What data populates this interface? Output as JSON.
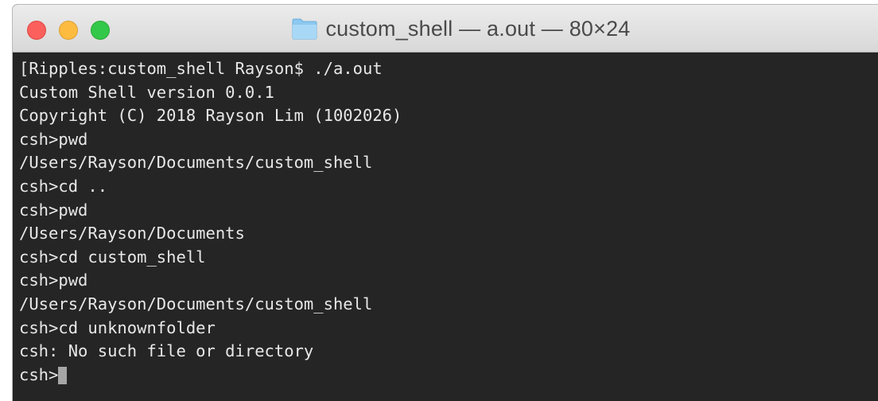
{
  "window": {
    "title": "custom_shell — a.out — 80×24"
  },
  "terminal": {
    "lines": [
      "[Ripples:custom_shell Rayson$ ./a.out",
      "Custom Shell version 0.0.1",
      "Copyright (C) 2018 Rayson Lim (1002026)",
      "csh>pwd",
      "/Users/Rayson/Documents/custom_shell",
      "csh>cd ..",
      "csh>pwd",
      "/Users/Rayson/Documents",
      "csh>cd custom_shell",
      "csh>pwd",
      "/Users/Rayson/Documents/custom_shell",
      "csh>cd unknownfolder",
      "csh: No such file or directory"
    ],
    "prompt": "csh>"
  },
  "colors": {
    "terminal_bg": "#252525",
    "terminal_fg": "#e8e8e8",
    "close": "#fc605c",
    "minimize": "#fdbc40",
    "zoom": "#34c84a",
    "folder": "#7ec0ee"
  },
  "icons": {
    "title_icon": "folder-icon"
  }
}
